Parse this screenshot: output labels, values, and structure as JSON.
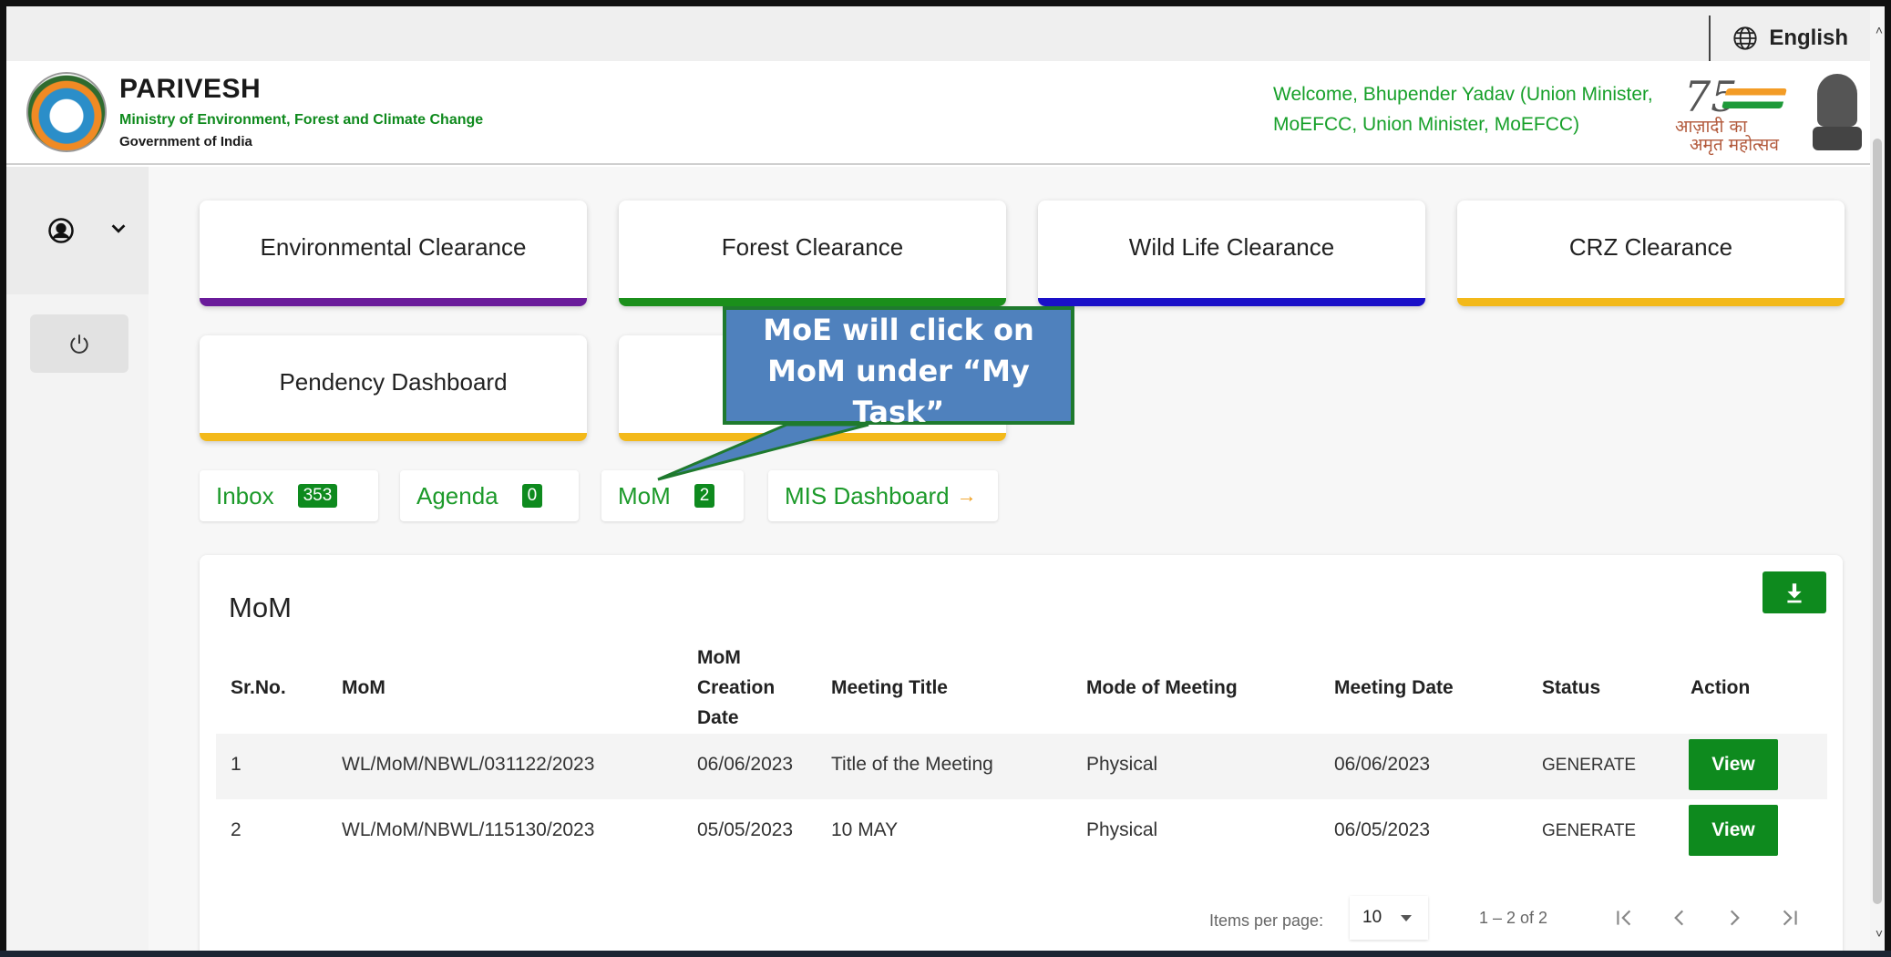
{
  "language": {
    "label": "English",
    "icon": "globe-icon"
  },
  "header": {
    "title": "PARIVESH",
    "ministry": "Ministry of Environment, Forest and Climate Change",
    "government": "Government of India",
    "welcome": "Welcome, Bhupender Yadav (Union Minister, MoEFCC, Union Minister, MoEFCC)",
    "azadi_number": "75",
    "azadi_line1": "आज़ादी का",
    "azadi_line2": "अमृत महोत्सव"
  },
  "sidebar": {
    "user_icon": "user-circle-icon",
    "chevron_icon": "chevron-down-icon",
    "power_icon": "power-icon"
  },
  "cards": [
    {
      "label": "Environmental Clearance",
      "color": "#6a1b9a"
    },
    {
      "label": "Forest Clearance",
      "color": "#1b8f1b"
    },
    {
      "label": "Wild Life Clearance",
      "color": "#1a10c8"
    },
    {
      "label": "CRZ Clearance",
      "color": "#f3b91a"
    },
    {
      "label": "Pendency Dashboard",
      "color": "#f3b91a"
    },
    {
      "label": "",
      "color": "#f3b91a"
    }
  ],
  "quick_links": [
    {
      "label": "Inbox",
      "count": "353"
    },
    {
      "label": "Agenda",
      "count": "0"
    },
    {
      "label": "MoM",
      "count": "2"
    },
    {
      "label": "MIS Dashboard",
      "arrow": "→"
    }
  ],
  "callout": {
    "line1": "MoE will click on",
    "line2": "MoM under “My",
    "line3": "Task”"
  },
  "table": {
    "title": "MoM",
    "download_icon": "download-icon",
    "headers": {
      "sr": "Sr.No.",
      "mom": "MoM",
      "created_1": "MoM",
      "created_2": "Creation",
      "created_3": "Date",
      "meeting_title": "Meeting Title",
      "mode": "Mode of Meeting",
      "meeting_date": "Meeting Date",
      "status": "Status",
      "action": "Action"
    },
    "rows": [
      {
        "sr": "1",
        "mom": "WL/MoM/NBWL/031122/2023",
        "created": "06/06/2023",
        "title": "Title of the Meeting",
        "mode": "Physical",
        "date": "06/06/2023",
        "status": "GENERATE",
        "action": "View"
      },
      {
        "sr": "2",
        "mom": "WL/MoM/NBWL/115130/2023",
        "created": "05/05/2023",
        "title": "10 MAY",
        "mode": "Physical",
        "date": "06/05/2023",
        "status": "GENERATE",
        "action": "View"
      }
    ],
    "paginator": {
      "items_label": "Items per page:",
      "page_size": "10",
      "range": "1 – 2 of 2"
    }
  }
}
